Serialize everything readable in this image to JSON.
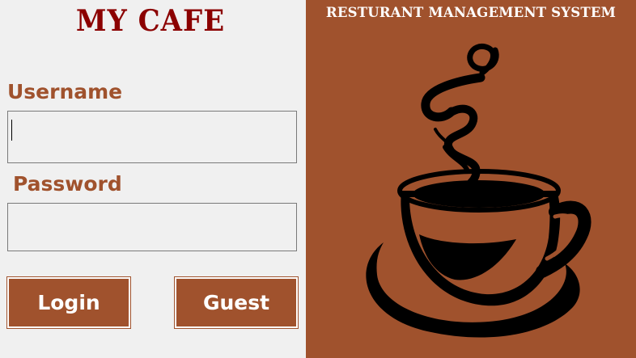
{
  "window": {
    "app_title": "MY CAFE",
    "system_title": "RESTURANT MANAGEMENT SYSTEM"
  },
  "login_form": {
    "username_label": "Username",
    "username_value": "",
    "password_label": "Password",
    "password_value": ""
  },
  "buttons": {
    "login_label": "Login",
    "guest_label": "Guest"
  },
  "artwork": {
    "icon": "coffee-cup-icon"
  },
  "colors": {
    "brand_brown": "#a0522d",
    "title_red": "#8b0000",
    "background": "#f0f0f0"
  }
}
